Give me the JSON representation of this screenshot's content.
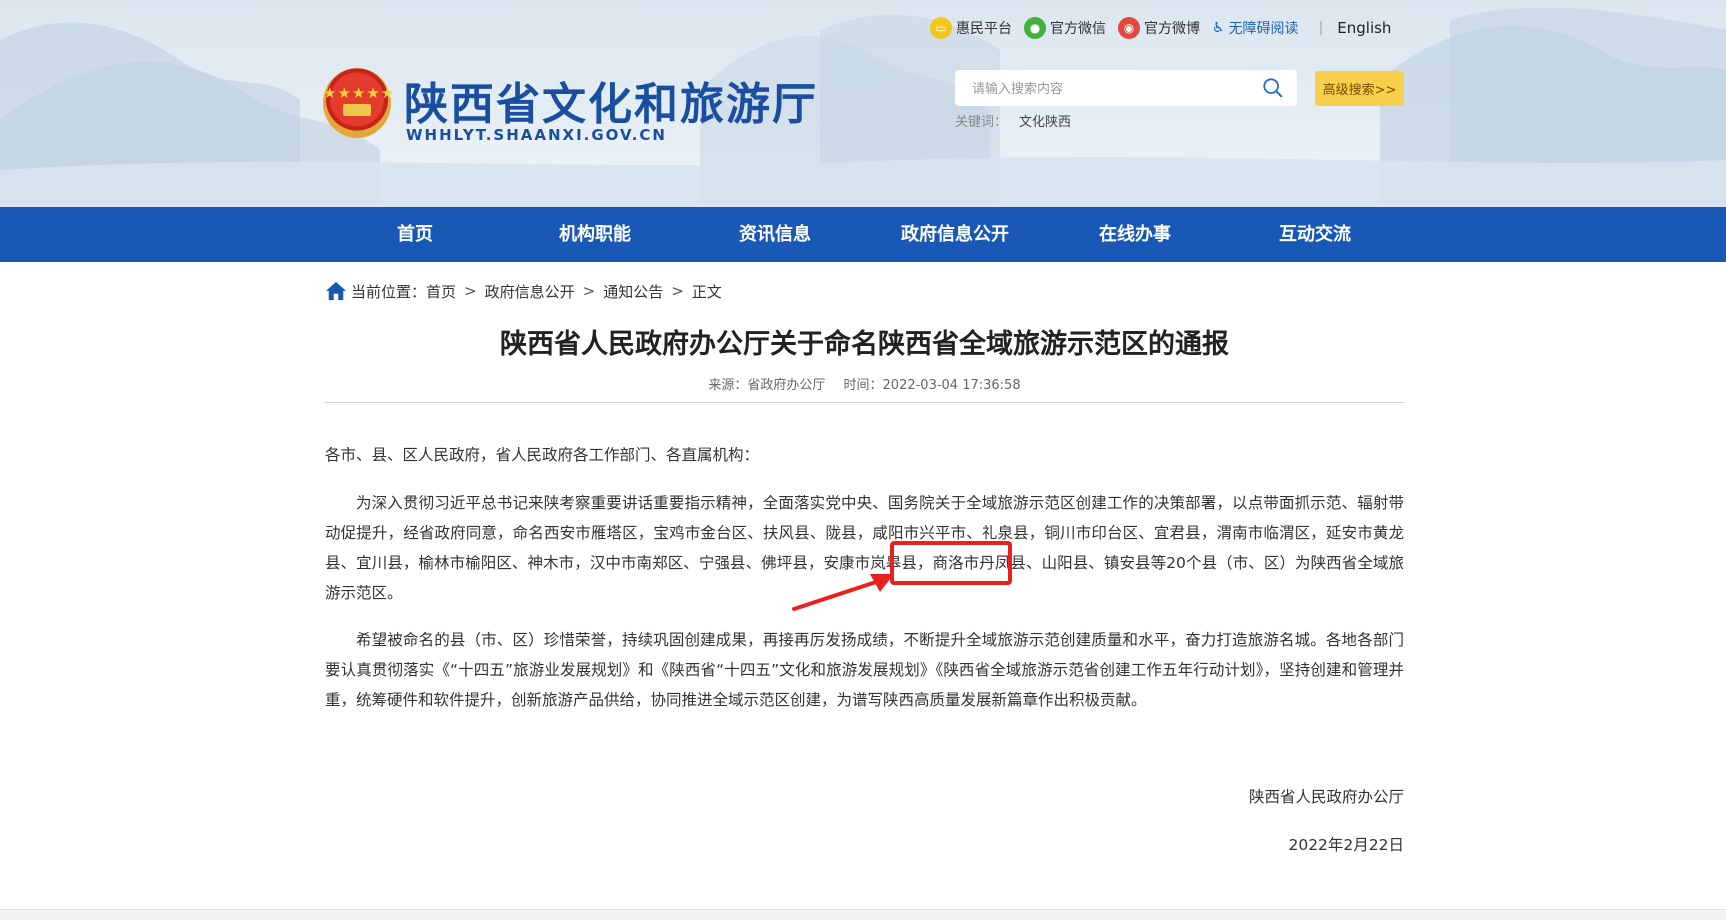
{
  "header": {
    "site_name": "陕西省文化和旅游厅",
    "site_url": "WHHLYT.SHAANXI.GOV.CN",
    "top_links": {
      "huimin": "惠民平台",
      "wechat": "官方微信",
      "weibo": "官方微博",
      "accessibility": "无障碍阅读",
      "separator": "|",
      "english": "English"
    },
    "search": {
      "placeholder": "请输入搜索内容",
      "advanced_label": "高级搜索>>",
      "keywords_label": "关键词：",
      "keyword_item": "文化陕西"
    }
  },
  "nav": {
    "items": [
      "首页",
      "机构职能",
      "资讯信息",
      "政府信息公开",
      "在线办事",
      "互动交流"
    ]
  },
  "breadcrumb": {
    "label": "当前位置：",
    "items": [
      "首页",
      "政府信息公开",
      "通知公告",
      "正文"
    ],
    "separator": ">"
  },
  "article": {
    "title": "陕西省人民政府办公厅关于命名陕西省全域旅游示范区的通报",
    "source": "来源：省政府办公厅",
    "time": "时间：2022-03-04 17:36:58",
    "salutation": "各市、县、区人民政府，省人民政府各工作部门、各直属机构：",
    "paragraph1": "为深入贯彻习近平总书记来陕考察重要讲话重要指示精神，全面落实党中央、国务院关于全域旅游示范区创建工作的决策部署，以点带面抓示范、辐射带动促提升，经省政府同意，命名西安市雁塔区，宝鸡市金台区、扶风县、陇县，咸阳市兴平市、礼泉县，铜川市印台区、宜君县，渭南市临渭区，延安市黄龙县、宜川县，榆林市榆阳区、神木市，汉中市南郑区、宁强县、佛坪县，安康市岚皋县，商洛市丹凤县、山阳县、镇安县等20个县（市、区）为陕西省全域旅游示范区。",
    "paragraph2": "希望被命名的县（市、区）珍惜荣誉，持续巩固创建成果，再接再厉发扬成绩，不断提升全域旅游示范创建质量和水平，奋力打造旅游名城。各地各部门要认真贯彻落实《“十四五”旅游业发展规划》和《陕西省“十四五”文化和旅游发展规划》《陕西省全域旅游示范省创建工作五年行动计划》，坚持创建和管理并重，统筹硬件和软件提升，创新旅游产品供给，协同推进全域示范区创建，为谱写陕西高质量发展新篇章作出积极贡献。",
    "signature_org": "陕西省人民政府办公厅",
    "signature_date": "2022年2月22日"
  },
  "colors": {
    "nav_bg": "#1958b4",
    "brand_blue": "#1a4fa0",
    "advanced_search_bg": "#f8cf4b",
    "annotation_red": "#e8211e"
  }
}
